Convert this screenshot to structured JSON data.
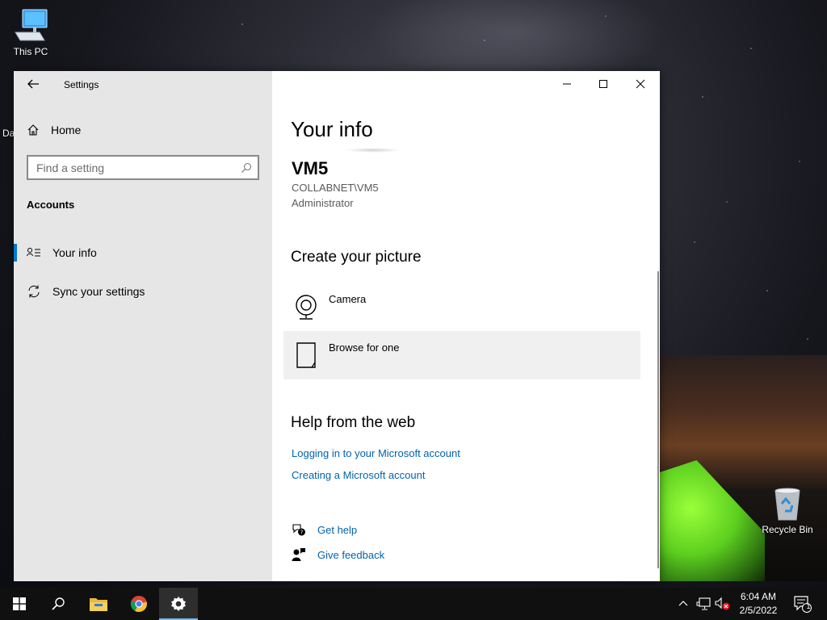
{
  "desktop": {
    "icons": [
      {
        "label": "This PC"
      },
      {
        "label": "Recycle Bin"
      }
    ],
    "partial_labels": {
      "left_edge": "Da"
    }
  },
  "window": {
    "title": "Settings",
    "controls": {
      "minimize": "minimize-icon",
      "maximize": "maximize-icon",
      "close": "close-icon"
    }
  },
  "sidebar": {
    "home_label": "Home",
    "search_placeholder": "Find a setting",
    "section_header": "Accounts",
    "items": [
      {
        "label": "Your info",
        "icon": "contact-icon",
        "active": true
      },
      {
        "label": "Sync your settings",
        "icon": "sync-icon",
        "active": false
      }
    ]
  },
  "main": {
    "page_title": "Your info",
    "user": {
      "name": "VM5",
      "account": "COLLABNET\\VM5",
      "role": "Administrator"
    },
    "create_picture": {
      "header": "Create your picture",
      "options": [
        {
          "label": "Camera",
          "icon": "camera-icon"
        },
        {
          "label": "Browse for one",
          "icon": "document-icon"
        }
      ]
    },
    "help_web": {
      "header": "Help from the web",
      "links": [
        "Logging in to your Microsoft account",
        "Creating a Microsoft account"
      ]
    },
    "support": {
      "get_help": "Get help",
      "give_feedback": "Give feedback"
    }
  },
  "taskbar": {
    "clock_time": "6:04 AM",
    "clock_date": "2/5/2022",
    "notification_count": "1",
    "accent_color": "#76b9ed"
  }
}
